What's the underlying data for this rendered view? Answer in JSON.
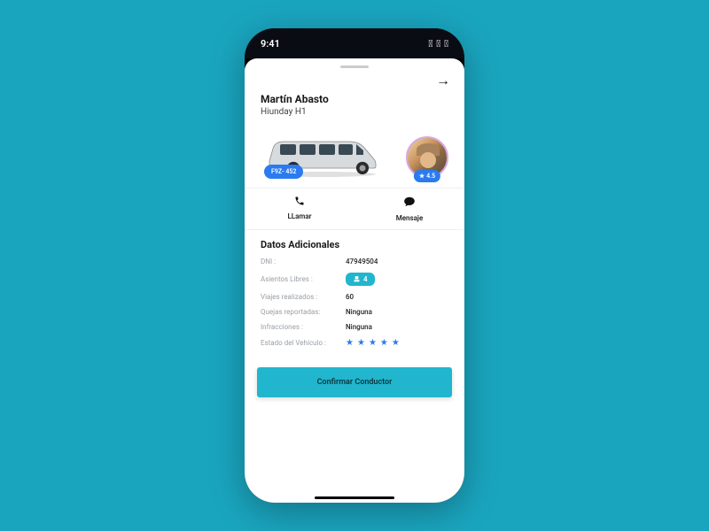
{
  "statusbar": {
    "time": "9:41"
  },
  "driver": {
    "name": "Martín Abasto",
    "vehicle_model": "Hiunday H1",
    "plate": "F9Z- 452",
    "rating": "4.5"
  },
  "actions": {
    "call_label": "LLamar",
    "message_label": "Mensaje"
  },
  "details": {
    "title": "Datos Adicionales",
    "dni_label": "DNI :",
    "dni_value": "47949504",
    "seats_label": "Asientos Libres :",
    "seats_value": "4",
    "trips_label": "Viajes realizados :",
    "trips_value": "60",
    "complaints_label": "Quejas reportadas:",
    "complaints_value": "Ninguna",
    "infractions_label": "Infracciones :",
    "infractions_value": "Ninguna",
    "vehicle_state_label": "Estado del Vehículo :",
    "vehicle_state_stars": 5
  },
  "confirm_label": "Confirmar Conductor"
}
